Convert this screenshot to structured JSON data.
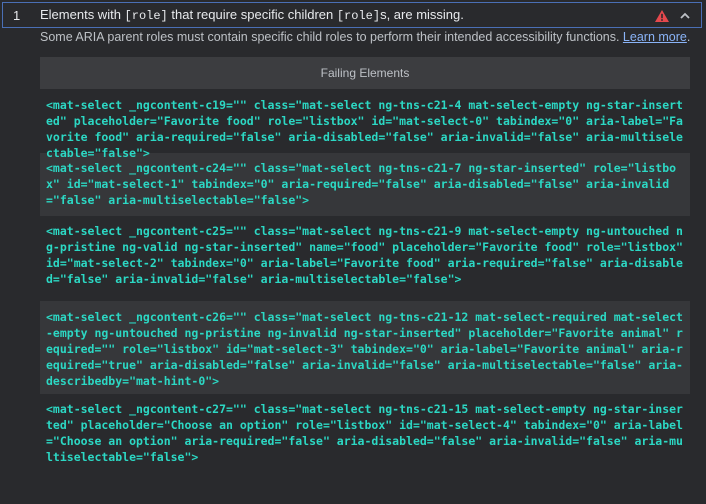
{
  "audit": {
    "index": "1",
    "title_prefix": "Elements with ",
    "title_code1": "[role]",
    "title_middle": " that require specific children ",
    "title_code2": "[role]",
    "title_suffix": "s, are missing.",
    "description": "Some ARIA parent roles must contain specific child roles to perform their intended accessibility functions. ",
    "learn_more": "Learn more",
    "period": ".",
    "status_color": "#e5484d"
  },
  "table": {
    "header": "Failing Elements",
    "rows": [
      "<mat-select _ngcontent-c19=\"\" class=\"mat-select ng-tns-c21-4 mat-select-empty ng-star-inserted\" placeholder=\"Favorite food\" role=\"listbox\" id=\"mat-select-0\" tabindex=\"0\" aria-label=\"Favorite food\" aria-required=\"false\" aria-disabled=\"false\" aria-invalid=\"false\" aria-multiselectable=\"false\">",
      "<mat-select _ngcontent-c24=\"\" class=\"mat-select ng-tns-c21-7 ng-star-inserted\" role=\"listbox\" id=\"mat-select-1\" tabindex=\"0\" aria-required=\"false\" aria-disabled=\"false\" aria-invalid=\"false\" aria-multiselectable=\"false\">",
      "<mat-select _ngcontent-c25=\"\" class=\"mat-select ng-tns-c21-9 mat-select-empty ng-untouched ng-pristine ng-valid ng-star-inserted\" name=\"food\" placeholder=\"Favorite food\" role=\"listbox\" id=\"mat-select-2\" tabindex=\"0\" aria-label=\"Favorite food\" aria-required=\"false\" aria-disabled=\"false\" aria-invalid=\"false\" aria-multiselectable=\"false\">",
      "<mat-select _ngcontent-c26=\"\" class=\"mat-select ng-tns-c21-12 mat-select-required mat-select-empty ng-untouched ng-pristine ng-invalid ng-star-inserted\" placeholder=\"Favorite animal\" required=\"\" role=\"listbox\" id=\"mat-select-3\" tabindex=\"0\" aria-label=\"Favorite animal\" aria-required=\"true\" aria-disabled=\"false\" aria-invalid=\"false\" aria-multiselectable=\"false\" aria-describedby=\"mat-hint-0\">",
      "<mat-select _ngcontent-c27=\"\" class=\"mat-select ng-tns-c21-15 mat-select-empty ng-star-inserted\" placeholder=\"Choose an option\" role=\"listbox\" id=\"mat-select-4\" tabindex=\"0\" aria-label=\"Choose an option\" aria-required=\"false\" aria-disabled=\"false\" aria-invalid=\"false\" aria-multiselectable=\"false\">"
    ]
  }
}
